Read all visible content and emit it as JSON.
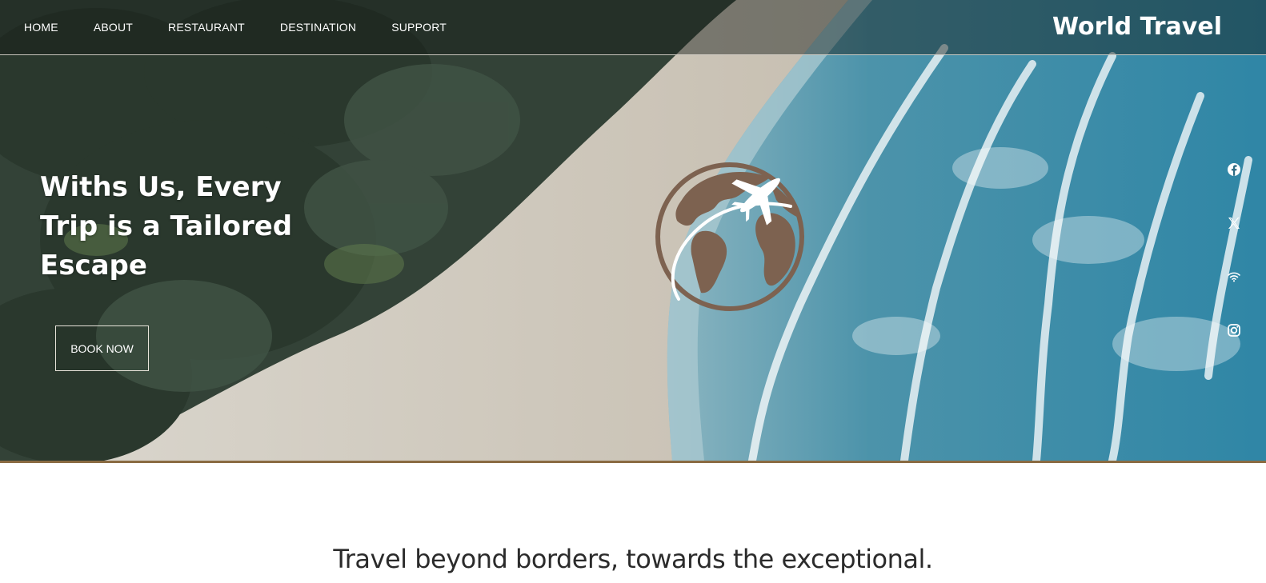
{
  "nav": {
    "items": [
      {
        "label": "HOME"
      },
      {
        "label": "ABOUT"
      },
      {
        "label": "RESTAURANT"
      },
      {
        "label": "DESTINATION"
      },
      {
        "label": "SUPPORT"
      }
    ],
    "brand": "World Travel"
  },
  "hero": {
    "headline": "Withs Us, Every Trip is a Tailored Escape",
    "cta_label": "BOOK NOW",
    "logo_icon": "globe-airplane-icon"
  },
  "social": {
    "icons": [
      "facebook-icon",
      "x-icon",
      "wifi-icon",
      "instagram-icon"
    ]
  },
  "colors": {
    "accent_brown": "#8a6b42",
    "logo_brown": "#7d6250",
    "nav_text": "#ffffff"
  },
  "tagline": "Travel beyond borders, towards the exceptional."
}
